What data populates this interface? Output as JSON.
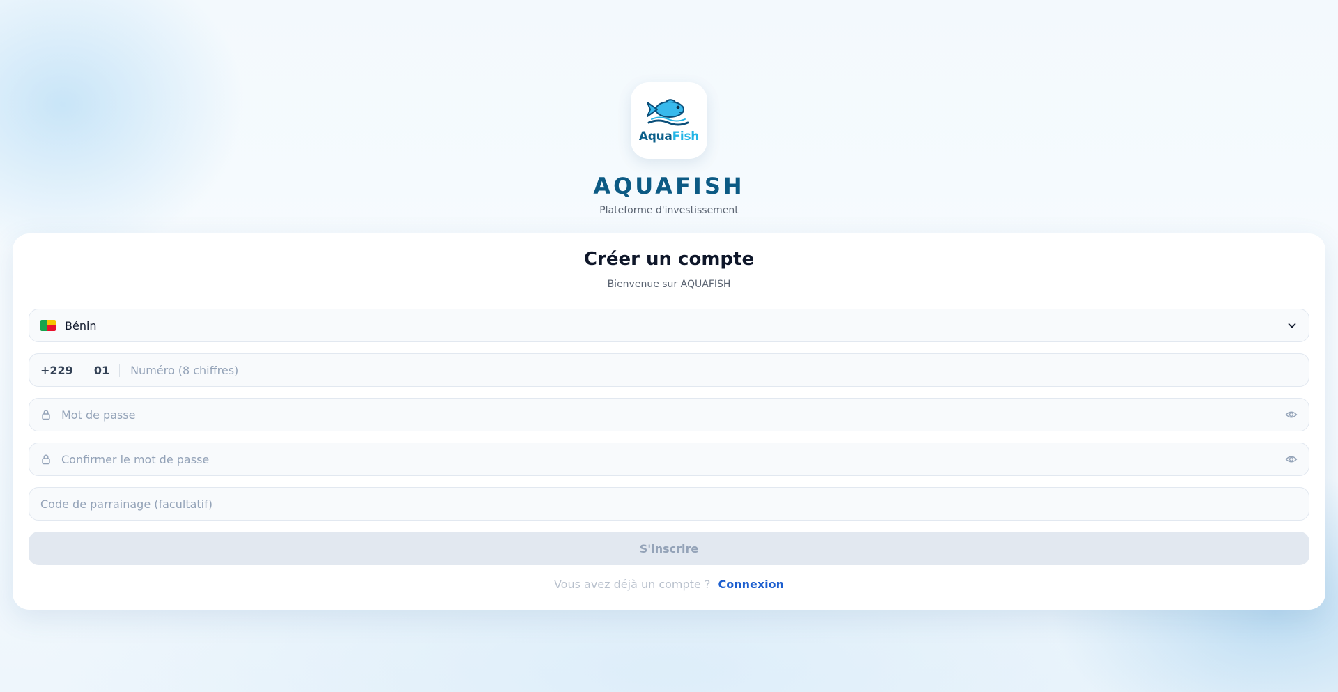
{
  "brand": {
    "logo_text_part1": "Aqua",
    "logo_text_part2": "Fish",
    "name": "AQUAFISH",
    "tagline": "Plateforme d'investissement"
  },
  "form": {
    "title": "Créer un compte",
    "subtitle": "Bienvenue sur AQUAFISH",
    "country": {
      "flag_icon": "benin-flag-icon",
      "selected": "Bénin"
    },
    "phone": {
      "country_code": "+229",
      "prefix": "01",
      "placeholder": "Numéro (8 chiffres)"
    },
    "password": {
      "placeholder": "Mot de passe"
    },
    "confirm_password": {
      "placeholder": "Confirmer le mot de passe"
    },
    "referral": {
      "placeholder": "Code de parrainage (facultatif)"
    },
    "submit_label": "S'inscrire",
    "login_prompt": "Vous avez déjà un compte ?",
    "login_link": "Connexion"
  },
  "colors": {
    "brand_dark": "#0c5a84",
    "brand_light": "#22b5e6",
    "link": "#1d5fcf",
    "button_disabled_bg": "#e2e8f0"
  }
}
